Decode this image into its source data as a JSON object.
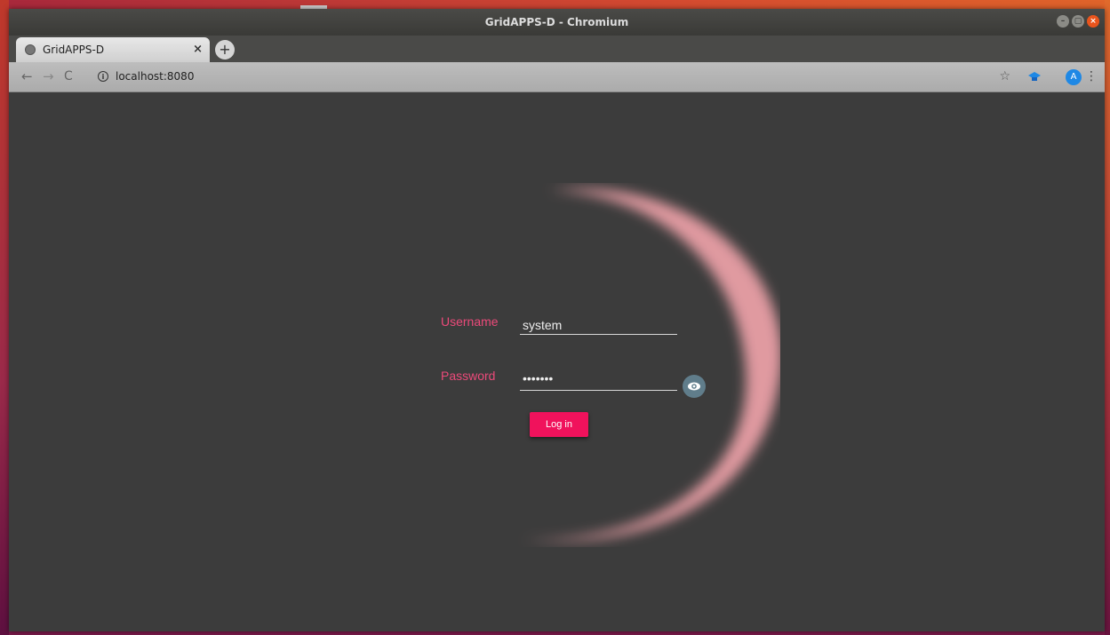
{
  "window": {
    "title": "GridAPPS-D - Chromium"
  },
  "tab": {
    "title": "GridAPPS-D",
    "close": "×",
    "new_tab": "+"
  },
  "toolbar": {
    "back": "←",
    "forward": "→",
    "reload": "C",
    "info": "i",
    "url": "localhost:8080",
    "bookmark": "☆",
    "profile_initial": "A",
    "menu": "⋮"
  },
  "login": {
    "username_label": "Username",
    "username_value": "system",
    "password_label": "Password",
    "password_value": "•••••••",
    "submit_label": "Log in"
  },
  "colors": {
    "accent": "#f0125c",
    "label": "#ec4a7a",
    "glow": "#e09aa0",
    "background": "#3c3c3c"
  },
  "icons": {
    "window_controls": [
      "minimize-icon",
      "maximize-icon",
      "close-icon"
    ],
    "password_toggle": "eye-icon",
    "extension": "graduation-cap-icon",
    "tab_favicon": "globe-icon"
  }
}
